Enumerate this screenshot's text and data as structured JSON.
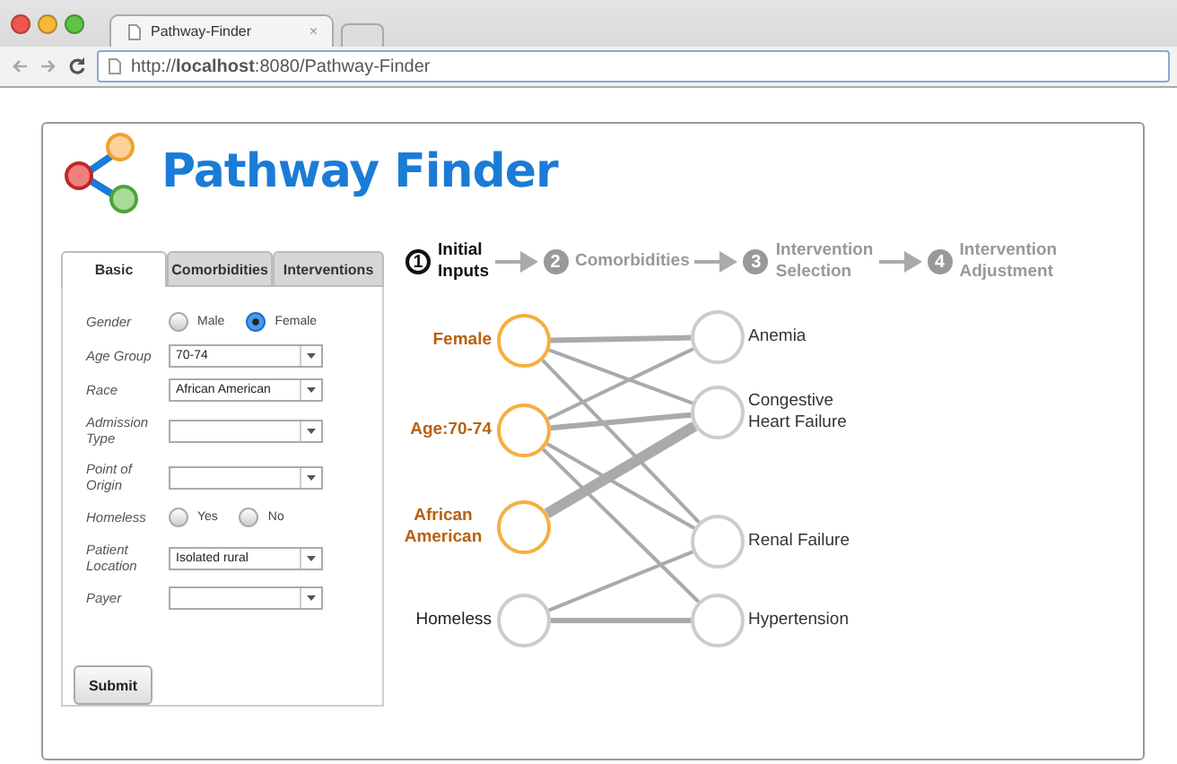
{
  "browser": {
    "tab_title": "Pathway-Finder",
    "tab_close": "×",
    "url": "http://**localhost**:8080/Pathway-Finder"
  },
  "app": {
    "title": "Pathway Finder"
  },
  "tabs": [
    {
      "label": "Basic",
      "selected": true
    },
    {
      "label": "Comorbidities",
      "selected": false
    },
    {
      "label": "Interventions",
      "selected": false
    }
  ],
  "form": [
    {
      "label": "Gender",
      "kind": "radio",
      "options": [
        {
          "label": "Male",
          "selected": false
        },
        {
          "label": "Female",
          "selected": true
        }
      ]
    },
    {
      "label": "Age Group",
      "kind": "select",
      "value": "70-74"
    },
    {
      "label": "Race",
      "kind": "select",
      "value": "African American"
    },
    {
      "label": "Admission Type",
      "kind": "select"
    },
    {
      "label": "Point of Origin",
      "kind": "select"
    },
    {
      "label": "Homeless",
      "kind": "radio",
      "options": [
        {
          "label": "Yes",
          "selected": false
        },
        {
          "label": "No",
          "selected": false
        }
      ]
    },
    {
      "label": "Patient Location",
      "kind": "select",
      "value": "Isolated rural"
    },
    {
      "label": "Payer",
      "kind": "select"
    }
  ],
  "submit_button": "Submit",
  "steps": [
    {
      "number": "1",
      "label": "Initial Inputs",
      "active": true
    },
    {
      "number": "2",
      "label": "Comorbidities",
      "active": false
    },
    {
      "number": "3",
      "label": "Intervention Selection",
      "active": false
    },
    {
      "number": "4",
      "label": "Intervention Adjustment",
      "active": false
    }
  ],
  "graph": {
    "factors": [
      {
        "label": "Female",
        "selected": true,
        "links": [
          {
            "kind": "medium"
          },
          {
            "kind": "thin"
          },
          {
            "kind": "thin"
          },
          {
            "kind": "none"
          }
        ]
      },
      {
        "label": "Age:70-74",
        "selected": true,
        "links": [
          {
            "kind": "thin"
          },
          {
            "kind": "medium"
          },
          {
            "kind": "thin"
          },
          {
            "kind": "thin"
          }
        ]
      },
      {
        "label": "African American",
        "selected": true,
        "links": [
          {
            "kind": "none"
          },
          {
            "kind": "thick"
          },
          {
            "kind": "none"
          },
          {
            "kind": "none"
          }
        ]
      },
      {
        "label": "Homeless",
        "selected": false,
        "links": [
          {
            "kind": "none"
          },
          {
            "kind": "none"
          },
          {
            "kind": "thin"
          },
          {
            "kind": "medium"
          }
        ]
      }
    ],
    "conditions": [
      {
        "label": "Anemia"
      },
      {
        "label": "Congestive Heart Failure"
      },
      {
        "label": "Renal Failure"
      },
      {
        "label": "Hypertension"
      }
    ]
  }
}
